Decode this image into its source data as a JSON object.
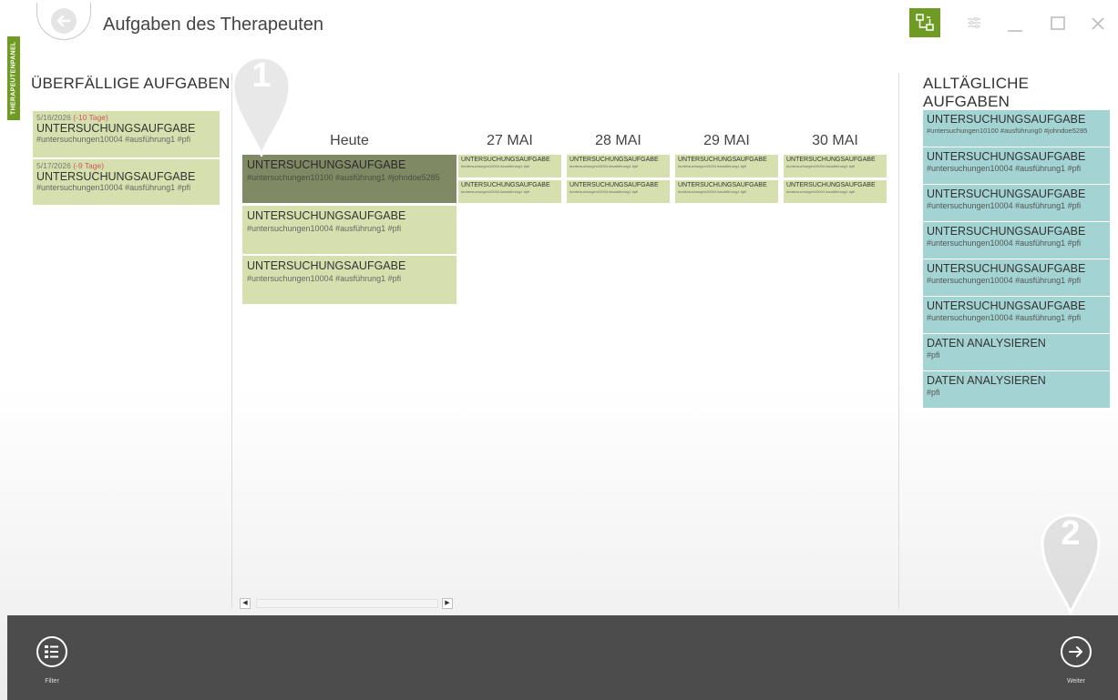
{
  "window": {
    "title": "Aufgaben des Therapeuten",
    "side_tab": "THERAPEUTENPANEL"
  },
  "overdue": {
    "heading": "ÜBERFÄLLIGE AUFGABEN",
    "items": [
      {
        "date": "5/16/2026",
        "late": "(-10 Tage)",
        "title": "UNTERSUCHUNGSAUFGABE",
        "tags": "#untersuchungen10004 #ausführung1 #pfi"
      },
      {
        "date": "5/17/2026",
        "late": "(-9 Tage)",
        "title": "UNTERSUCHUNGSAUFGABE",
        "tags": "#untersuchungen10004 #ausführung1 #pfi"
      }
    ]
  },
  "calendar": {
    "days": [
      "Heute",
      "27 MAI",
      "28 MAI",
      "29 MAI",
      "30 MAI"
    ],
    "today_items": [
      {
        "title": "UNTERSUCHUNGSAUFGABE",
        "tags": "#untersuchungen10100 #ausführung1 #johndoe5285"
      },
      {
        "title": "UNTERSUCHUNGSAUFGABE",
        "tags": "#untersuchungen10004 #ausführung1 #pfi"
      },
      {
        "title": "UNTERSUCHUNGSAUFGABE",
        "tags": "#untersuchungen10004 #ausführung1 #pfi"
      }
    ],
    "mini": {
      "title": "UNTERSUCHUNGSAUFGABE",
      "tags": "#untersuchungen10004 #ausführung1 #pfi"
    }
  },
  "daily": {
    "heading": "ALLTÄGLICHE AUFGABEN",
    "items": [
      {
        "title": "UNTERSUCHUNGSAUFGABE",
        "tags": "#untersuchungen10100 #ausführung0 #johndoe5285"
      },
      {
        "title": "UNTERSUCHUNGSAUFGABE",
        "tags": "#untersuchungen10004 #ausführung1 #pfi"
      },
      {
        "title": "UNTERSUCHUNGSAUFGABE",
        "tags": "#untersuchungen10004 #ausführung1 #pfi"
      },
      {
        "title": "UNTERSUCHUNGSAUFGABE",
        "tags": "#untersuchungen10004 #ausführung1 #pfi"
      },
      {
        "title": "UNTERSUCHUNGSAUFGABE",
        "tags": "#untersuchungen10004 #ausführung1 #pfi"
      },
      {
        "title": "UNTERSUCHUNGSAUFGABE",
        "tags": "#untersuchungen10004 #ausführung1 #pfi"
      },
      {
        "title": "DATEN ANALYSIEREN",
        "tags": "#pfi"
      },
      {
        "title": "DATEN ANALYSIEREN",
        "tags": "#pfi"
      }
    ]
  },
  "bottom": {
    "filter_label": "Filter",
    "next_label": "Weiter"
  },
  "markers": {
    "one": "1",
    "two": "2"
  },
  "icons": {
    "back": "back-arrow-icon",
    "network": "network-icon",
    "settings": "sliders-icon",
    "minimize": "minimize-icon",
    "maximize": "maximize-icon",
    "close": "close-icon",
    "filter": "list-icon",
    "next": "arrow-right-icon"
  },
  "colors": {
    "accent": "#6f9a23",
    "task_green": "#d6e0ae",
    "task_teal": "#a3d3d3",
    "bottom_bar": "#4c4c4c",
    "late": "#d05656"
  }
}
